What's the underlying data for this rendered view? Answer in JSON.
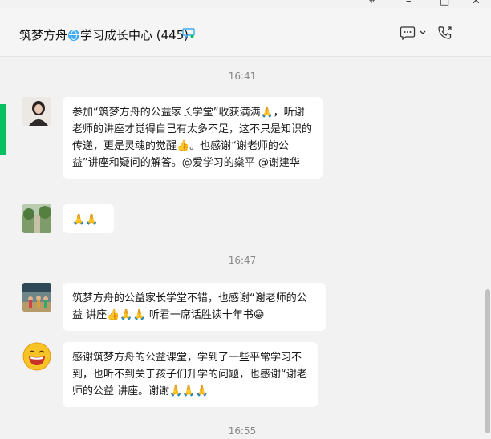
{
  "window": {
    "controls": [
      "pin",
      "minimize",
      "maximize",
      "close"
    ]
  },
  "header": {
    "title_part1": "筑梦方舟",
    "title_part2": "学习成长中心 (445)",
    "icons": [
      "globe-icon",
      "chat-bubble-icon",
      "more-icon",
      "chevron-down-icon",
      "voice-call-icon"
    ]
  },
  "messages": {
    "time1": "16:41",
    "msg1": {
      "text": "参加“筑梦方舟的公益家长学堂”收获满满🙏，听谢老师的讲座才觉得自己有太多不足，这不只是知识的传递，更是灵魂的觉醒👍。也感谢“谢老师的公益”讲座和疑问的解答。@爱学习的燊平 @谢建华"
    },
    "msg2": {
      "text": "🙏🙏"
    },
    "time2": "16:47",
    "msg3": {
      "text": "筑梦方舟的公益家长学堂不错，也感谢“谢老师的公益 讲座👍🙏🙏  听君一席话胜读十年书😁"
    },
    "msg4": {
      "text": "感谢筑梦方舟的公益课堂，学到了一些平常学习不到，也听不到关于孩子们升学的问题，也感谢“谢老师的公益 讲座。谢谢🙏🙏🙏"
    },
    "time3": "16:55"
  },
  "colors": {
    "accent": "#07c160",
    "bubble": "#ffffff",
    "background": "#f2f2f2"
  }
}
